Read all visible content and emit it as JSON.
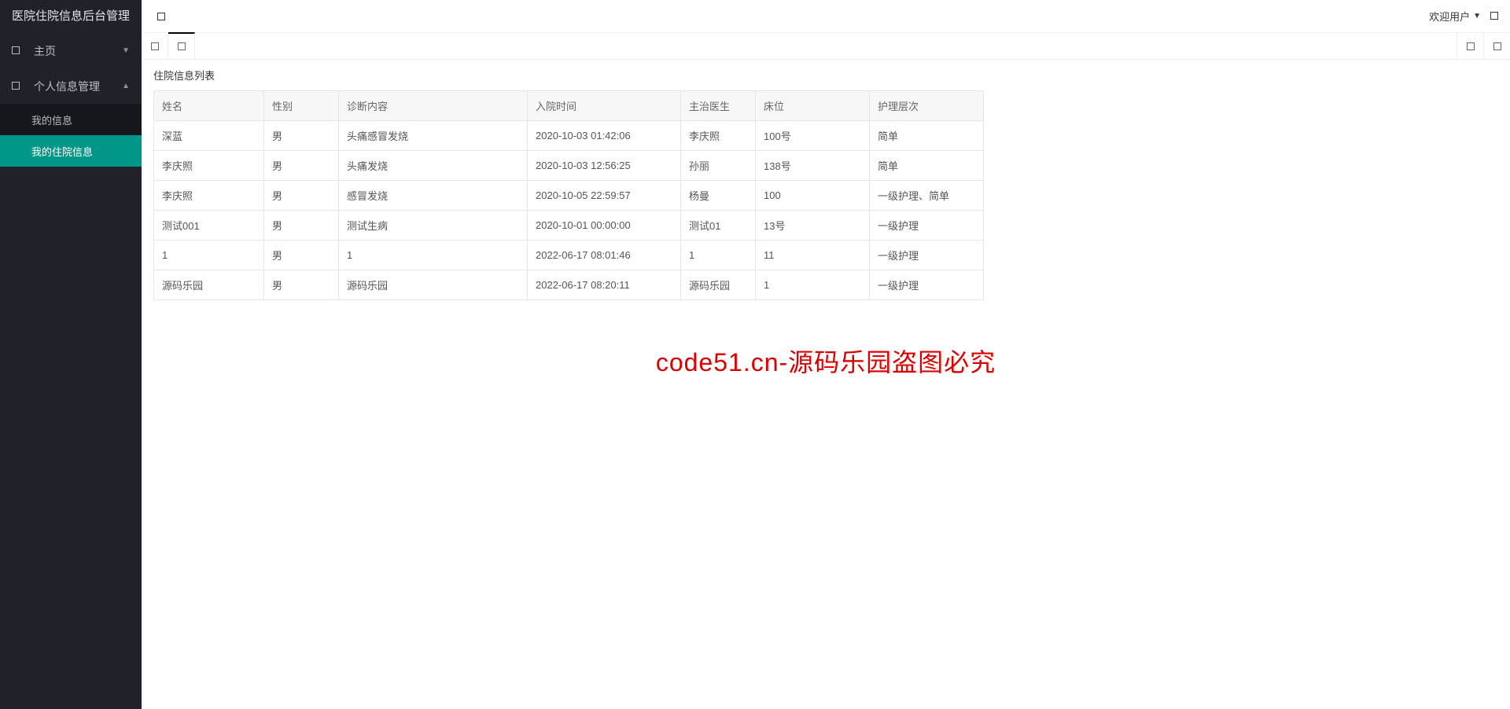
{
  "app_title": "医院住院信息后台管理",
  "header": {
    "welcome": "欢迎用户"
  },
  "sidebar": {
    "home": "主页",
    "personal": "个人信息管理",
    "sub": {
      "myinfo": "我的信息",
      "myhosp": "我的住院信息"
    }
  },
  "section_title": "住院信息列表",
  "table": {
    "headers": {
      "name": "姓名",
      "gender": "性别",
      "diag": "诊断内容",
      "time": "入院时间",
      "doctor": "主治医生",
      "bed": "床位",
      "level": "护理层次"
    },
    "rows": [
      {
        "name": "深蓝",
        "gender": "男",
        "diag": "头痛感冒发烧",
        "time": "2020-10-03 01:42:06",
        "doctor": "李庆照",
        "bed": "100号",
        "level": "简单"
      },
      {
        "name": "李庆照",
        "gender": "男",
        "diag": "头痛发烧",
        "time": "2020-10-03 12:56:25",
        "doctor": "孙丽",
        "bed": "138号",
        "level": "简单"
      },
      {
        "name": "李庆照",
        "gender": "男",
        "diag": "感冒发烧",
        "time": "2020-10-05 22:59:57",
        "doctor": "杨曼",
        "bed": "100",
        "level": "一级护理、简单"
      },
      {
        "name": "测试001",
        "gender": "男",
        "diag": "测试生病",
        "time": "2020-10-01 00:00:00",
        "doctor": "测试01",
        "bed": "13号",
        "level": "一级护理"
      },
      {
        "name": "1",
        "gender": "男",
        "diag": "1",
        "time": "2022-06-17 08:01:46",
        "doctor": "1",
        "bed": "11",
        "level": "一级护理"
      },
      {
        "name": "源码乐园",
        "gender": "男",
        "diag": "源码乐园",
        "time": "2022-06-17 08:20:11",
        "doctor": "源码乐园",
        "bed": "1",
        "level": "一级护理"
      }
    ]
  },
  "watermark": "code51.cn-源码乐园盗图必究"
}
